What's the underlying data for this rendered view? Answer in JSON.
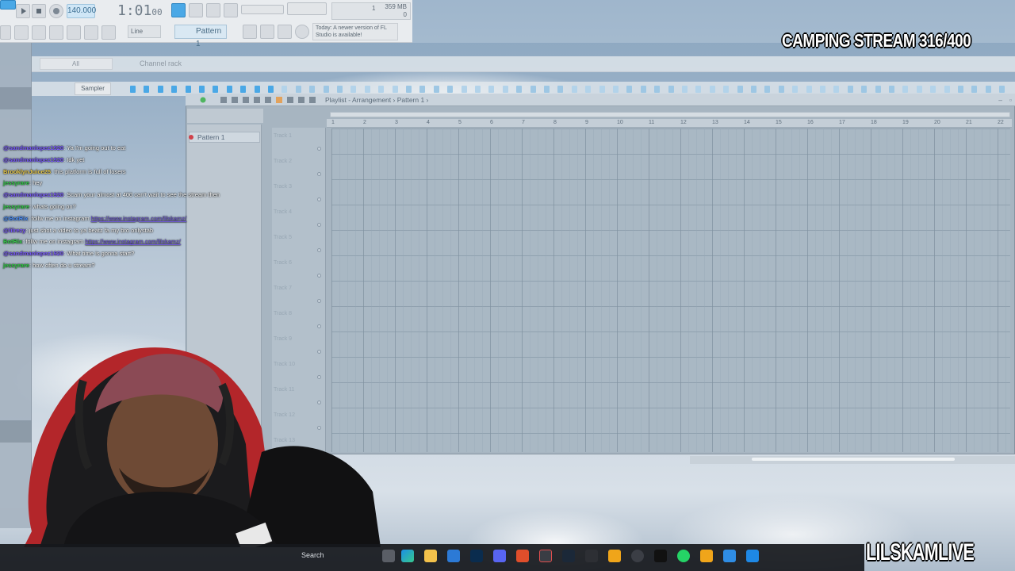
{
  "toolbar": {
    "tempo": "140.000",
    "clock_main": "1:01",
    "clock_sub": "00",
    "cpu_top": "359 MB",
    "cpu_num": "1",
    "cpu_bottom": "0",
    "snap": "Line",
    "pattern": "Pattern 1",
    "news": "Today: A newer version of FL Studio is available!"
  },
  "channel_rack": {
    "filter": "All",
    "title": "Channel rack",
    "instrument": "Sampler"
  },
  "playlist": {
    "breadcrumb": "Playlist - Arrangement › Pattern 1 ›",
    "pattern_item": "Pattern 1",
    "tracks": [
      "Track 1",
      "Track 2",
      "Track 3",
      "Track 4",
      "Track 5",
      "Track 6",
      "Track 7",
      "Track 8",
      "Track 9",
      "Track 10",
      "Track 11",
      "Track 12",
      "Track 13"
    ],
    "ruler": [
      "1",
      "2",
      "3",
      "4",
      "5",
      "6",
      "7",
      "8",
      "9",
      "10",
      "11",
      "12",
      "13",
      "14",
      "15",
      "16",
      "17",
      "18",
      "19",
      "20",
      "21",
      "22"
    ]
  },
  "chat": [
    {
      "user": "@sandmanlopez1920",
      "text": ": Ya I'm going out to eat",
      "user_color": "#7b5cff",
      "link": ""
    },
    {
      "user": "@sandmanlopez1920",
      "text": ": Idk yet",
      "user_color": "#7b5cff",
      "link": ""
    },
    {
      "user": "BrooklynJuice25",
      "text": ": this platform is full of losers",
      "user_color": "#e8c94a",
      "link": ""
    },
    {
      "user": "jessyrare",
      "text": ": hey",
      "user_color": "#35d24a",
      "link": ""
    },
    {
      "user": "@sandmanlopez1920",
      "text": ": Scam your almost at 400 can't wait to see the stream then",
      "user_color": "#7b5cff",
      "link": ""
    },
    {
      "user": "jessyrare",
      "text": ": whats going on?",
      "user_color": "#35d24a",
      "link": ""
    },
    {
      "user": "@BotRix",
      "text": ": follw me on instagram ",
      "user_color": "#4a90ff",
      "link": "https://www.instagram.com/lilskamz/"
    },
    {
      "user": "@lilrezy",
      "text": ": just shot a video to ya beatz fa my bro onlystab",
      "user_color": "#7b5cff",
      "link": ""
    },
    {
      "user": "BotRix",
      "text": ": follw me on instagram ",
      "user_color": "#35d24a",
      "link": "https://www.instagram.com/lilskamz/"
    },
    {
      "user": "@sandmanlopez1920",
      "text": ": What time is gonna start?",
      "user_color": "#7b5cff",
      "link": ""
    },
    {
      "user": "jessyrare",
      "text": ": how often do u stream?",
      "user_color": "#35d24a",
      "link": ""
    }
  ],
  "taskbar": {
    "search": "Search"
  },
  "overlay": {
    "title": "CAMPING STREAM 316/400",
    "brand": "LILSKAMLIVE"
  },
  "colors": {
    "accent": "#4aa8e6",
    "pattern_dot": "#d0414a",
    "chat_link": "#6f59d8"
  }
}
